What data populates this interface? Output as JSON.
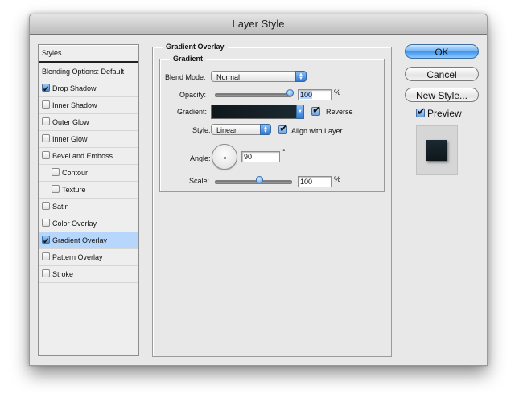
{
  "window": {
    "title": "Layer Style"
  },
  "styles_list": {
    "header": "Styles",
    "blending_options": "Blending Options: Default",
    "items": [
      {
        "label": "Drop Shadow",
        "checked": true,
        "sub": false,
        "selected": false
      },
      {
        "label": "Inner Shadow",
        "checked": false,
        "sub": false,
        "selected": false
      },
      {
        "label": "Outer Glow",
        "checked": false,
        "sub": false,
        "selected": false
      },
      {
        "label": "Inner Glow",
        "checked": false,
        "sub": false,
        "selected": false
      },
      {
        "label": "Bevel and Emboss",
        "checked": false,
        "sub": false,
        "selected": false
      },
      {
        "label": "Contour",
        "checked": false,
        "sub": true,
        "selected": false
      },
      {
        "label": "Texture",
        "checked": false,
        "sub": true,
        "selected": false
      },
      {
        "label": "Satin",
        "checked": false,
        "sub": false,
        "selected": false
      },
      {
        "label": "Color Overlay",
        "checked": false,
        "sub": false,
        "selected": false
      },
      {
        "label": "Gradient Overlay",
        "checked": true,
        "sub": false,
        "selected": true
      },
      {
        "label": "Pattern Overlay",
        "checked": false,
        "sub": false,
        "selected": false
      },
      {
        "label": "Stroke",
        "checked": false,
        "sub": false,
        "selected": false
      }
    ]
  },
  "gradient_overlay": {
    "section_title": "Gradient Overlay",
    "group_title": "Gradient",
    "blend_mode_label": "Blend Mode:",
    "blend_mode_value": "Normal",
    "opacity_label": "Opacity:",
    "opacity_value": "100",
    "opacity_percent": 100,
    "opacity_unit": "%",
    "gradient_label": "Gradient:",
    "gradient_colors": [
      "#0f171b",
      "#1b2a32"
    ],
    "reverse_label": "Reverse",
    "reverse_checked": true,
    "style_label": "Style:",
    "style_value": "Linear",
    "align_label": "Align with Layer",
    "align_checked": true,
    "angle_label": "Angle:",
    "angle_value": "90",
    "angle_unit": "°",
    "scale_label": "Scale:",
    "scale_value": "100",
    "scale_unit": "%",
    "scale_slider_fraction": 0.6
  },
  "buttons": {
    "ok": "OK",
    "cancel": "Cancel",
    "new_style": "New Style..."
  },
  "preview": {
    "label": "Preview",
    "checked": true
  }
}
